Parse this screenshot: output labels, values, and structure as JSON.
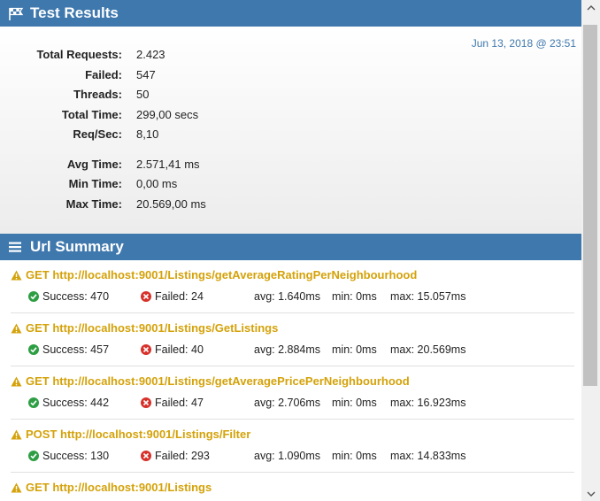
{
  "test_results": {
    "title": "Test Results",
    "timestamp": "Jun 13, 2018 @ 23:51",
    "stats": [
      {
        "label": "Total Requests:",
        "value": "2.423"
      },
      {
        "label": "Failed:",
        "value": "547"
      },
      {
        "label": "Threads:",
        "value": "50"
      },
      {
        "label": "Total Time:",
        "value": "299,00 secs"
      },
      {
        "label": "Req/Sec:",
        "value": "8,10"
      }
    ],
    "timing": [
      {
        "label": "Avg Time:",
        "value": "2.571,41 ms"
      },
      {
        "label": "Min Time:",
        "value": "0,00 ms"
      },
      {
        "label": "Max Time:",
        "value": "20.569,00 ms"
      }
    ]
  },
  "url_summary": {
    "title": "Url Summary",
    "items": [
      {
        "title": "GET http://localhost:9001/Listings/getAverageRatingPerNeighbourhood",
        "success": "Success: 470",
        "failed": "Failed: 24",
        "avg": "avg: 1.640ms",
        "min": "min: 0ms",
        "max": "max: 15.057ms"
      },
      {
        "title": "GET http://localhost:9001/Listings/GetListings",
        "success": "Success: 457",
        "failed": "Failed: 40",
        "avg": "avg: 2.884ms",
        "min": "min: 0ms",
        "max": "max: 20.569ms"
      },
      {
        "title": "GET http://localhost:9001/Listings/getAveragePricePerNeighbourhood",
        "success": "Success: 442",
        "failed": "Failed: 47",
        "avg": "avg: 2.706ms",
        "min": "min: 0ms",
        "max": "max: 16.923ms"
      },
      {
        "title": "POST http://localhost:9001/Listings/Filter",
        "success": "Success: 130",
        "failed": "Failed: 293",
        "avg": "avg: 1.090ms",
        "min": "min: 0ms",
        "max": "max: 14.833ms"
      },
      {
        "title": "GET http://localhost:9001/Listings"
      }
    ]
  },
  "icons": {
    "results_header": "flag-icon",
    "summary_header": "list-icon",
    "url_warning": "warning-icon",
    "success": "check-circle-icon",
    "failed": "x-circle-icon"
  },
  "colors": {
    "header_bg": "#3f78ad",
    "url_title": "#d4a20a",
    "success": "#2e9e44",
    "failed": "#d7312a"
  }
}
